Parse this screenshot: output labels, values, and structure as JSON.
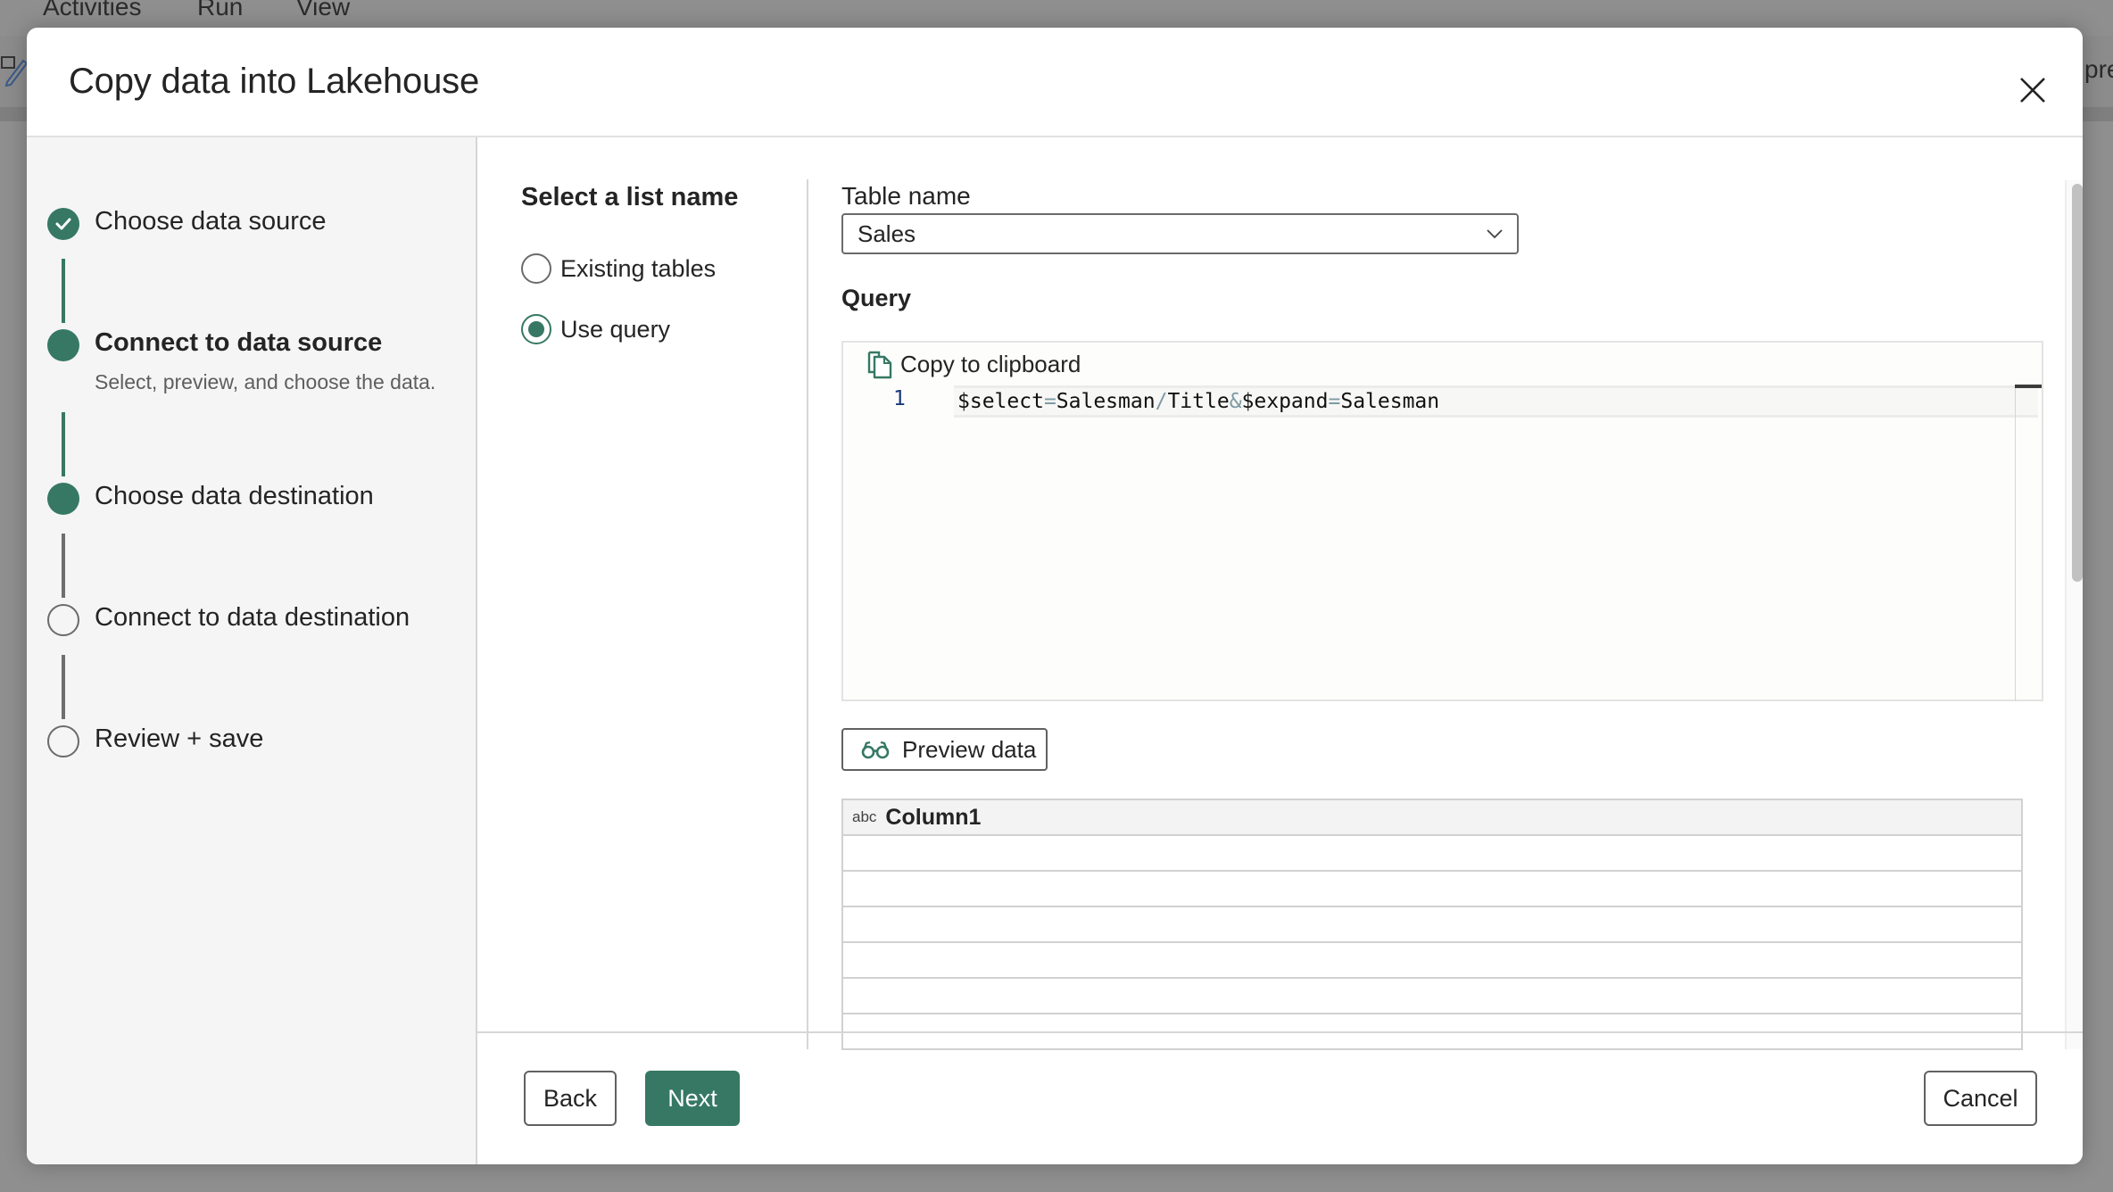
{
  "background_app": {
    "menu": [
      "Activities",
      "Run",
      "View"
    ],
    "partial_text": "pre"
  },
  "dialog": {
    "title": "Copy data into Lakehouse",
    "close_icon": "close-icon"
  },
  "stepper": {
    "steps": [
      {
        "label": "Choose data source",
        "state": "done"
      },
      {
        "label": "Connect to data source",
        "state": "active",
        "subtitle": "Select, preview, and choose the data."
      },
      {
        "label": "Choose data destination",
        "state": "active"
      },
      {
        "label": "Connect to data destination",
        "state": "pending"
      },
      {
        "label": "Review + save",
        "state": "pending"
      }
    ]
  },
  "list_selection": {
    "title": "Select a list name",
    "options": [
      {
        "label": "Existing tables",
        "checked": false
      },
      {
        "label": "Use query",
        "checked": true
      }
    ]
  },
  "table_name": {
    "label": "Table name",
    "value": "Sales"
  },
  "query": {
    "label": "Query",
    "copy_label": "Copy to clipboard",
    "lines": [
      {
        "number": "1",
        "tokens": [
          {
            "t": "$select",
            "k": "text"
          },
          {
            "t": "=",
            "k": "op"
          },
          {
            "t": "Salesman",
            "k": "text"
          },
          {
            "t": "/",
            "k": "op"
          },
          {
            "t": "Title",
            "k": "text"
          },
          {
            "t": "&",
            "k": "op"
          },
          {
            "t": "$expand",
            "k": "text"
          },
          {
            "t": "=",
            "k": "op"
          },
          {
            "t": "Salesman",
            "k": "text"
          }
        ]
      }
    ]
  },
  "preview": {
    "button_label": "Preview data",
    "columns": [
      {
        "type": "abc",
        "name": "Column1"
      }
    ],
    "rows": [
      [
        ""
      ],
      [
        ""
      ],
      [
        ""
      ],
      [
        ""
      ],
      [
        ""
      ],
      [
        ""
      ]
    ]
  },
  "footer": {
    "back_label": "Back",
    "next_label": "Next",
    "cancel_label": "Cancel"
  },
  "colors": {
    "accent": "#367864",
    "pane_bg": "#f5f5f5",
    "overlay": "#8f8f8f"
  }
}
